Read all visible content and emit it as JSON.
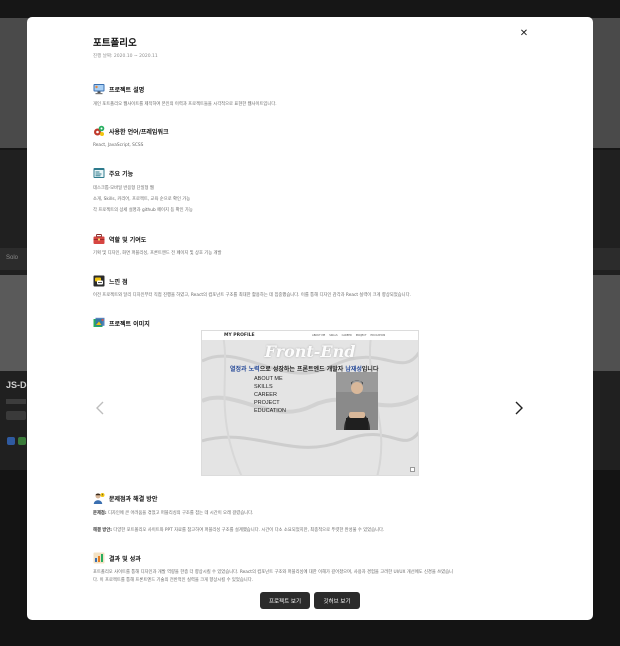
{
  "background": {
    "band_label": "Solo",
    "project_title": "JS-De"
  },
  "modal": {
    "title": "포트폴리오",
    "period": "진행 날짜: 2020.10 ~ 2020.11",
    "close_icon": "close-icon",
    "sections": {
      "description": {
        "icon": "monitor-icon",
        "title": "프로젝트 설명",
        "lines": [
          "개인 포트폴리오 웹사이트를 제작하여 본인의 이력과 프로젝트들을 시각적으로 표현한 웹사이트입니다."
        ]
      },
      "stack": {
        "icon": "gears-icon",
        "title": "사용한 언어/프레임워크",
        "lines": [
          "React, JavaScript, SCSS"
        ]
      },
      "features": {
        "icon": "browser-icon",
        "title": "주요 기능",
        "lines": [
          "데스크톱·모바일 반응형 단일형 웹",
          "소개, Skills, 커리어, 프로젝트, 교육 순으로 확인 가능",
          "각 프로젝트의 상세 설명과 github 페이지 등 확인 가능"
        ]
      },
      "role": {
        "icon": "toolbox-icon",
        "title": "역할 및 기여도",
        "lines": [
          "기획 및 디자인, 화면 퍼블리싱, 프론트엔드 전 페이지 및 상호 기능 개발"
        ]
      },
      "thoughts": {
        "icon": "chat-icon",
        "title": "느낀 점",
        "lines": [
          "이전 프로젝트와 달리 디자인부터 직접 진행을 하였고, React의 컴포넌트 구조를 최대한 활용하는 데 집중했습니다. 이를 통해 디자인 감각과 React 실력이 크게 향상되었습니다."
        ]
      },
      "images": {
        "icon": "image-icon",
        "title": "프로젝트 이미지"
      },
      "problem": {
        "icon": "person-icon",
        "title": "문제점과 해결 방안",
        "problem_label": "문제점:",
        "problem_text": " 디자인에 큰 어려움을 겪었고 퍼블리싱의 구조를 잡는 데 시간이 오래 걸렸습니다.",
        "solution_label": "해결 방안:",
        "solution_text": " 다양한 포트폴리오 사이트와 PPT 자료를 참고하여 퍼블리싱 구조를 설계했습니다. 시간이 다소 소요되었지만, 최종적으로 뚜렷한 완성물 수 있었습니다."
      },
      "result": {
        "icon": "chart-icon",
        "title": "결과 및 성과",
        "lines": [
          "포트폴리오 사이트를 통해 디자인과 개발 역량을 한층 더 향상시킬 수 있었습니다. React의 컴포넌트 구조와 퍼블리싱에 대한 이해가 깊어졌으며, 사용자 경험을 고려한 UI/UX 개선에도 신경을 쓰였습니",
          "다. 이 프로젝트를 통해 프론트엔드 기술의 전반적인 실력을 크게 향상시킬 수 있었습니다."
        ]
      }
    },
    "carousel": {
      "brand": "MY PROFILE",
      "menu": [
        "ABOUT ME",
        "SKILLS",
        "CAREER",
        "PROJECT",
        "EDUCATION"
      ],
      "hero": "Front-End",
      "tagline_a": "열정과 노력",
      "tagline_b": "으로 성장하는 프론트엔드 개발자 ",
      "tagline_c": "남재성",
      "tagline_d": "입니다",
      "links": [
        "ABOUT ME",
        "SKILLS",
        "CAREER",
        "PROJECT",
        "EDUCATION"
      ],
      "prev_icon": "chevron-left-icon",
      "next_icon": "chevron-right-icon"
    },
    "buttons": {
      "view_project": "프로젝트 보기",
      "view_github": "깃허브 보기"
    }
  }
}
